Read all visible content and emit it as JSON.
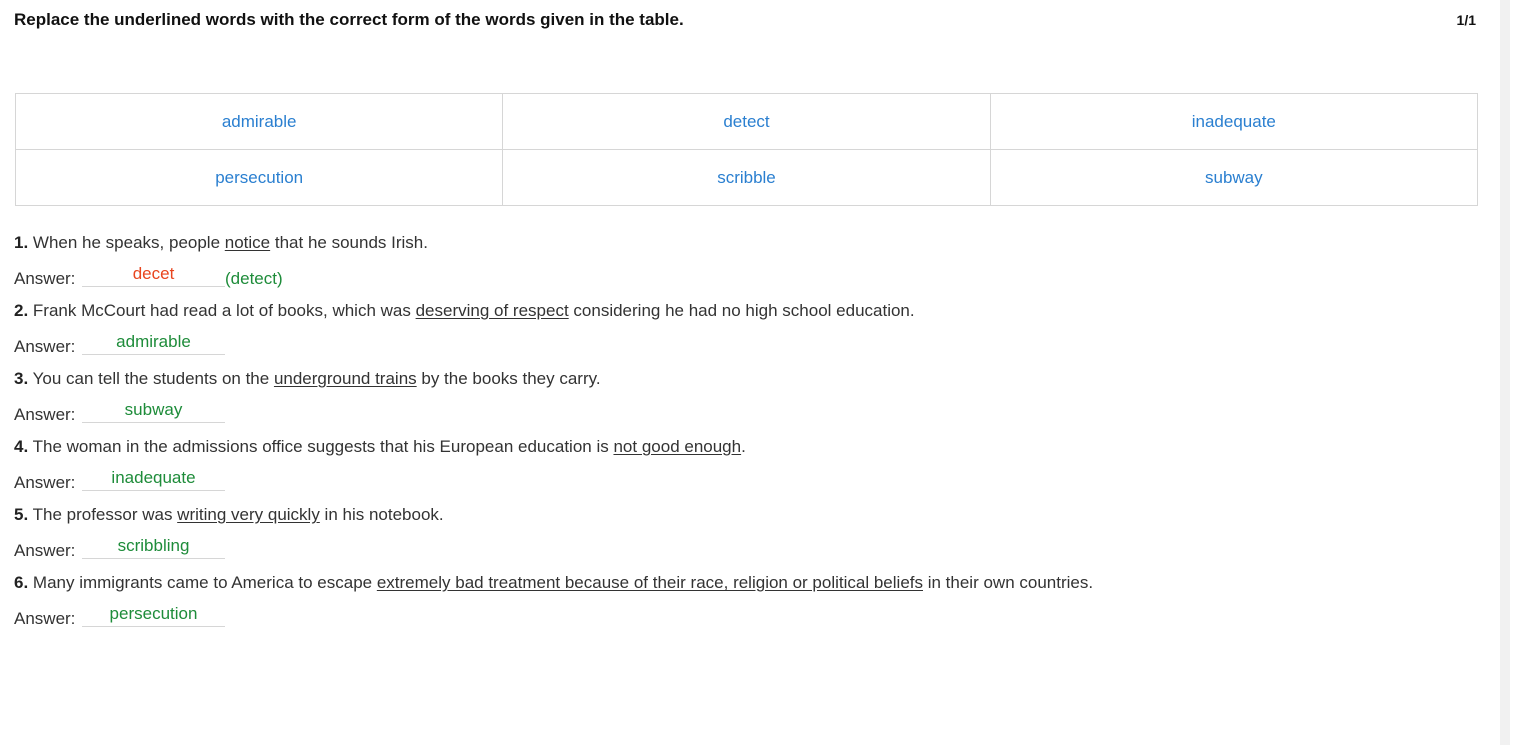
{
  "header": {
    "instruction": "Replace the underlined words with the correct form of the words given in the table.",
    "page_counter": "1/1"
  },
  "word_table": {
    "rows": [
      [
        "admirable",
        "detect",
        "inadequate"
      ],
      [
        "persecution",
        "scribble",
        "subway"
      ]
    ]
  },
  "answer_label": "Answer:",
  "colors": {
    "table_word": "#2a7fd0",
    "correct_answer": "#1e8c3a",
    "wrong_answer": "#e8451e"
  },
  "questions": [
    {
      "number": "1.",
      "before": " When he speaks, people ",
      "underlined": "notice",
      "after": " that he sounds Irish.",
      "answer": "decet",
      "status": "wrong",
      "hint": "(detect)"
    },
    {
      "number": "2.",
      "before": " Frank McCourt had read a lot of books, which was ",
      "underlined": "deserving of respect",
      "after": " considering he had no high school education.",
      "answer": "admirable",
      "status": "correct"
    },
    {
      "number": "3.",
      "before": " You can tell the students on the ",
      "underlined": "underground trains",
      "after": " by the books they carry.",
      "answer": "subway",
      "status": "correct"
    },
    {
      "number": "4.",
      "before": " The woman in the admissions office suggests that his European education is ",
      "underlined": "not good enough",
      "after": ".",
      "answer": "inadequate",
      "status": "correct"
    },
    {
      "number": "5.",
      "before": " The professor was ",
      "underlined": "writing very quickly",
      "after": " in his notebook.",
      "answer": "scribbling",
      "status": "correct"
    },
    {
      "number": "6.",
      "before": " Many immigrants came to America to escape ",
      "underlined": "extremely bad treatment because of their race, religion or political beliefs",
      "after": " in their own countries.",
      "answer": "persecution",
      "status": "correct"
    }
  ]
}
